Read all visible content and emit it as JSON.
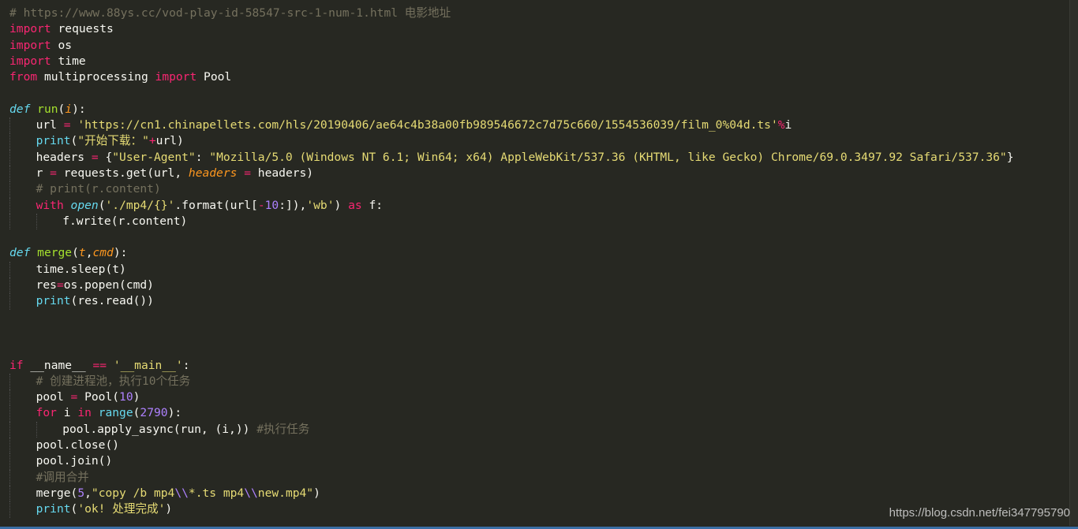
{
  "code_lines": [
    {
      "indent": 0,
      "tokens": [
        {
          "t": "# https://www.88ys.cc/vod-play-id-58547-src-1-num-1.html 电影地址",
          "c": "cmt"
        }
      ]
    },
    {
      "indent": 0,
      "tokens": [
        {
          "t": "import",
          "c": "kw"
        },
        {
          "t": " requests",
          "c": "txt"
        }
      ]
    },
    {
      "indent": 0,
      "tokens": [
        {
          "t": "import",
          "c": "kw"
        },
        {
          "t": " os",
          "c": "txt"
        }
      ]
    },
    {
      "indent": 0,
      "tokens": [
        {
          "t": "import",
          "c": "kw"
        },
        {
          "t": " time",
          "c": "txt"
        }
      ]
    },
    {
      "indent": 0,
      "tokens": [
        {
          "t": "from",
          "c": "kw"
        },
        {
          "t": " multiprocessing ",
          "c": "txt"
        },
        {
          "t": "import",
          "c": "kw"
        },
        {
          "t": " Pool",
          "c": "txt"
        }
      ]
    },
    {
      "indent": 0,
      "tokens": []
    },
    {
      "indent": 0,
      "tokens": [
        {
          "t": "def",
          "c": "def"
        },
        {
          "t": " ",
          "c": "txt"
        },
        {
          "t": "run",
          "c": "nm"
        },
        {
          "t": "(",
          "c": "txt"
        },
        {
          "t": "i",
          "c": "par"
        },
        {
          "t": "):",
          "c": "txt"
        }
      ]
    },
    {
      "indent": 1,
      "tokens": [
        {
          "t": "url ",
          "c": "txt"
        },
        {
          "t": "=",
          "c": "kw"
        },
        {
          "t": " ",
          "c": "txt"
        },
        {
          "t": "'https://cn1.chinapellets.com/hls/20190406/ae64c4b38a00fb989546672c7d75c660/1554536039/film_0%04d.ts'",
          "c": "str"
        },
        {
          "t": "%",
          "c": "kw"
        },
        {
          "t": "i",
          "c": "txt"
        }
      ]
    },
    {
      "indent": 1,
      "tokens": [
        {
          "t": "print",
          "c": "fn"
        },
        {
          "t": "(",
          "c": "txt"
        },
        {
          "t": "\"开始下载：\"",
          "c": "str"
        },
        {
          "t": "+",
          "c": "kw"
        },
        {
          "t": "url)",
          "c": "txt"
        }
      ]
    },
    {
      "indent": 1,
      "tokens": [
        {
          "t": "headers ",
          "c": "txt"
        },
        {
          "t": "=",
          "c": "kw"
        },
        {
          "t": " {",
          "c": "txt"
        },
        {
          "t": "\"User-Agent\"",
          "c": "str"
        },
        {
          "t": ": ",
          "c": "txt"
        },
        {
          "t": "\"Mozilla/5.0 (Windows NT 6.1; Win64; x64) AppleWebKit/537.36 (KHTML, like Gecko) Chrome/69.0.3497.92 Safari/537.36\"",
          "c": "str"
        },
        {
          "t": "}",
          "c": "txt"
        }
      ]
    },
    {
      "indent": 1,
      "tokens": [
        {
          "t": "r ",
          "c": "txt"
        },
        {
          "t": "=",
          "c": "kw"
        },
        {
          "t": " requests.get(url, ",
          "c": "txt"
        },
        {
          "t": "headers",
          "c": "par"
        },
        {
          "t": " ",
          "c": "txt"
        },
        {
          "t": "=",
          "c": "kw"
        },
        {
          "t": " headers)",
          "c": "txt"
        }
      ]
    },
    {
      "indent": 1,
      "tokens": [
        {
          "t": "# print(r.content)",
          "c": "cmt"
        }
      ]
    },
    {
      "indent": 1,
      "tokens": [
        {
          "t": "with",
          "c": "kw"
        },
        {
          "t": " ",
          "c": "txt"
        },
        {
          "t": "open",
          "c": "def"
        },
        {
          "t": "(",
          "c": "txt"
        },
        {
          "t": "'./mp4/{}'",
          "c": "str"
        },
        {
          "t": ".format(url[",
          "c": "txt"
        },
        {
          "t": "-",
          "c": "kw"
        },
        {
          "t": "10",
          "c": "num"
        },
        {
          "t": ":]),",
          "c": "txt"
        },
        {
          "t": "'wb'",
          "c": "str"
        },
        {
          "t": ") ",
          "c": "txt"
        },
        {
          "t": "as",
          "c": "kw"
        },
        {
          "t": " f:",
          "c": "txt"
        }
      ]
    },
    {
      "indent": 2,
      "tokens": [
        {
          "t": "f.write(r.content)",
          "c": "txt"
        }
      ]
    },
    {
      "indent": 0,
      "tokens": []
    },
    {
      "indent": 0,
      "tokens": [
        {
          "t": "def",
          "c": "def"
        },
        {
          "t": " ",
          "c": "txt"
        },
        {
          "t": "merge",
          "c": "nm"
        },
        {
          "t": "(",
          "c": "txt"
        },
        {
          "t": "t",
          "c": "par"
        },
        {
          "t": ",",
          "c": "txt"
        },
        {
          "t": "cmd",
          "c": "par"
        },
        {
          "t": "):",
          "c": "txt"
        }
      ]
    },
    {
      "indent": 1,
      "tokens": [
        {
          "t": "time.sleep(t)",
          "c": "txt"
        }
      ]
    },
    {
      "indent": 1,
      "tokens": [
        {
          "t": "res",
          "c": "txt"
        },
        {
          "t": "=",
          "c": "kw"
        },
        {
          "t": "os.popen(cmd)",
          "c": "txt"
        }
      ]
    },
    {
      "indent": 1,
      "tokens": [
        {
          "t": "print",
          "c": "fn"
        },
        {
          "t": "(res.read())",
          "c": "txt"
        }
      ]
    },
    {
      "indent": 0,
      "tokens": []
    },
    {
      "indent": 0,
      "tokens": []
    },
    {
      "indent": 0,
      "tokens": []
    },
    {
      "indent": 0,
      "tokens": [
        {
          "t": "if",
          "c": "kw"
        },
        {
          "t": " __name__ ",
          "c": "txt"
        },
        {
          "t": "==",
          "c": "kw"
        },
        {
          "t": " ",
          "c": "txt"
        },
        {
          "t": "'__main__'",
          "c": "str"
        },
        {
          "t": ":",
          "c": "txt"
        }
      ]
    },
    {
      "indent": 1,
      "tokens": [
        {
          "t": "# 创建进程池，执行10个任务",
          "c": "cmt"
        }
      ]
    },
    {
      "indent": 1,
      "tokens": [
        {
          "t": "pool ",
          "c": "txt"
        },
        {
          "t": "=",
          "c": "kw"
        },
        {
          "t": " Pool(",
          "c": "txt"
        },
        {
          "t": "10",
          "c": "num"
        },
        {
          "t": ")",
          "c": "txt"
        }
      ]
    },
    {
      "indent": 1,
      "tokens": [
        {
          "t": "for",
          "c": "kw"
        },
        {
          "t": " i ",
          "c": "txt"
        },
        {
          "t": "in",
          "c": "kw"
        },
        {
          "t": " ",
          "c": "txt"
        },
        {
          "t": "range",
          "c": "fn"
        },
        {
          "t": "(",
          "c": "txt"
        },
        {
          "t": "2790",
          "c": "num"
        },
        {
          "t": "):",
          "c": "txt"
        }
      ]
    },
    {
      "indent": 2,
      "tokens": [
        {
          "t": "pool.apply_async(run, (i,)) ",
          "c": "txt"
        },
        {
          "t": "#执行任务",
          "c": "cmt"
        }
      ]
    },
    {
      "indent": 1,
      "tokens": [
        {
          "t": "pool.close()",
          "c": "txt"
        }
      ]
    },
    {
      "indent": 1,
      "tokens": [
        {
          "t": "pool.join()",
          "c": "txt"
        }
      ]
    },
    {
      "indent": 1,
      "tokens": [
        {
          "t": "#调用合并",
          "c": "cmt"
        }
      ]
    },
    {
      "indent": 1,
      "tokens": [
        {
          "t": "merge(",
          "c": "txt"
        },
        {
          "t": "5",
          "c": "num"
        },
        {
          "t": ",",
          "c": "txt"
        },
        {
          "t": "\"copy /b mp4",
          "c": "str"
        },
        {
          "t": "\\\\",
          "c": "num"
        },
        {
          "t": "*.ts mp4",
          "c": "str"
        },
        {
          "t": "\\\\",
          "c": "num"
        },
        {
          "t": "new.mp4\"",
          "c": "str"
        },
        {
          "t": ")",
          "c": "txt"
        }
      ]
    },
    {
      "indent": 1,
      "tokens": [
        {
          "t": "print",
          "c": "fn"
        },
        {
          "t": "(",
          "c": "txt"
        },
        {
          "t": "'ok! 处理完成'",
          "c": "str"
        },
        {
          "t": ")",
          "c": "txt"
        }
      ]
    }
  ],
  "watermark": "https://blog.csdn.net/fei347795790",
  "colors": {
    "background": "#272822",
    "keyword": "#f92672",
    "function_name": "#a6e22e",
    "string": "#e6db74",
    "number": "#ae81ff",
    "comment": "#75715e",
    "parameter": "#fd971f",
    "builtin": "#66d9ef",
    "text": "#f8f8f2"
  }
}
